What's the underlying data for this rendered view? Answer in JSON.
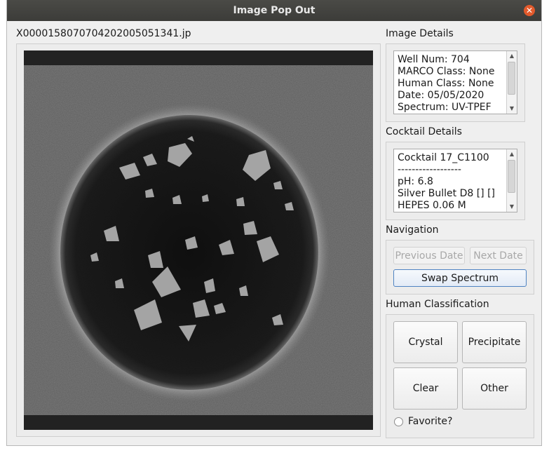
{
  "window": {
    "title": "Image Pop Out"
  },
  "image": {
    "filename": "X0000158070704202005051341.jp"
  },
  "image_details": {
    "label": "Image Details",
    "lines": [
      "Well Num: 704",
      "MARCO Class: None",
      "Human Class: None",
      "Date: 05/05/2020",
      "Spectrum: UV-TPEF"
    ]
  },
  "cocktail_details": {
    "label": "Cocktail Details",
    "lines": [
      "Cocktail 17_C1100",
      "------------------",
      "pH: 6.8",
      "Silver Bullet D8 [] []",
      "HEPES 0.06 M"
    ]
  },
  "navigation": {
    "label": "Navigation",
    "previous_date": "Previous Date",
    "next_date": "Next Date",
    "swap_spectrum": "Swap Spectrum"
  },
  "human_classification": {
    "label": "Human Classification",
    "crystal": "Crystal",
    "precipitate": "Precipitate",
    "clear": "Clear",
    "other": "Other",
    "favorite": "Favorite?"
  }
}
